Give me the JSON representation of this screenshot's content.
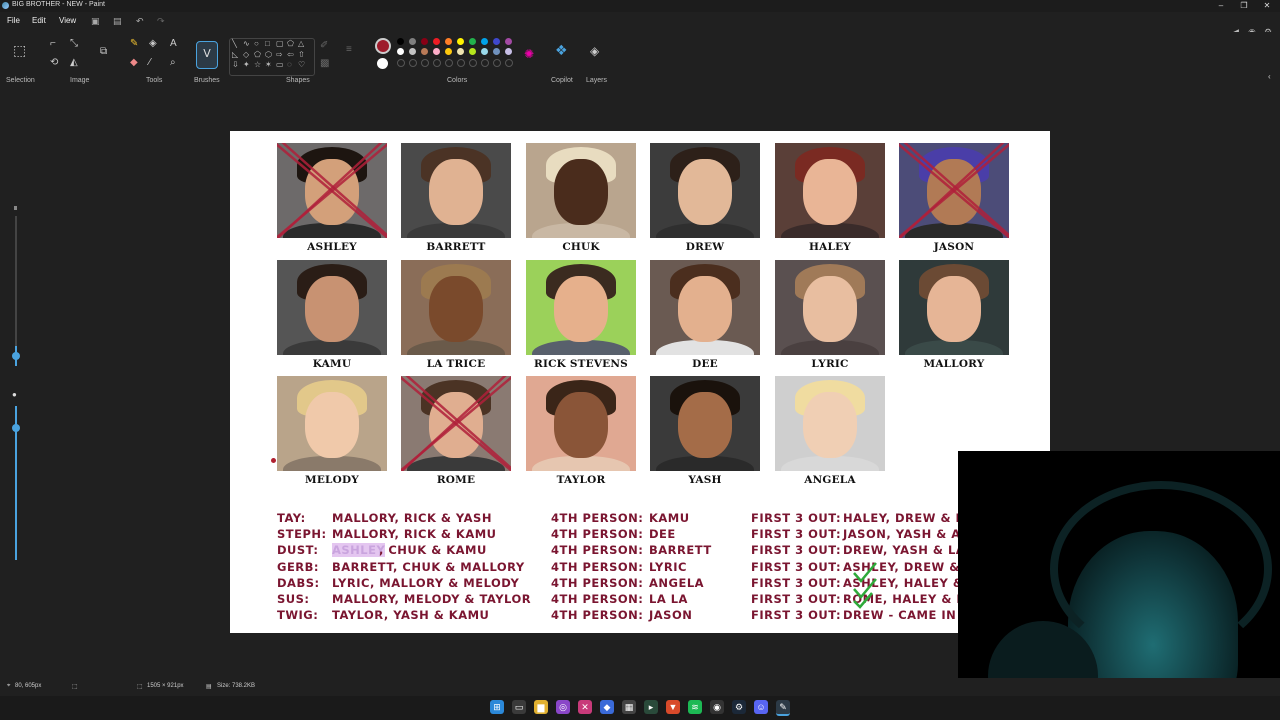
{
  "window": {
    "title": "BIG BROTHER - NEW - Paint",
    "minimize": "–",
    "maximize": "❐",
    "close": "✕"
  },
  "menu": {
    "file": "File",
    "edit": "Edit",
    "view": "View"
  },
  "ribbon": {
    "groups": {
      "selection": "Selection",
      "image": "Image",
      "tools": "Tools",
      "brushes": "Brushes",
      "shapes": "Shapes",
      "colors": "Colors",
      "copilot": "Copilot",
      "layers": "Layers"
    },
    "primary_color": "#9e1b2b",
    "secondary_color": "#ffffff",
    "palette_row1": [
      "#000000",
      "#7f7f7f",
      "#880015",
      "#ed1c24",
      "#ff7f27",
      "#fff200",
      "#22b14c",
      "#00a2e8",
      "#3f48cc",
      "#a349a4"
    ],
    "palette_row2": [
      "#ffffff",
      "#c3c3c3",
      "#b97a57",
      "#ffaec9",
      "#ffc90e",
      "#efe4b0",
      "#b5e61d",
      "#99d9ea",
      "#7092be",
      "#c8bfe7"
    ]
  },
  "contestants": [
    {
      "name": "ASHLEY",
      "x_mark": true,
      "bg": "#6d6a6a",
      "skin": "#d3a07a",
      "hair": "#1d1510",
      "shirt": "#2b2b2b"
    },
    {
      "name": "BARRETT",
      "x_mark": false,
      "bg": "#4a4a4a",
      "skin": "#e0b292",
      "hair": "#4b3325",
      "shirt": "#3a3a3a"
    },
    {
      "name": "CHUK",
      "x_mark": false,
      "bg": "#b9a58e",
      "skin": "#4a2c1c",
      "hair": "#e8dcc0",
      "shirt": "#c9b8a4"
    },
    {
      "name": "DREW",
      "x_mark": false,
      "bg": "#3c3c3c",
      "skin": "#e2b898",
      "hair": "#2d2019",
      "shirt": "#2f2f2f"
    },
    {
      "name": "HALEY",
      "x_mark": false,
      "bg": "#5a3f38",
      "skin": "#e9b596",
      "hair": "#7a2a22",
      "shirt": "#3a2b2a"
    },
    {
      "name": "JASON",
      "x_mark": true,
      "bg": "#4c4c78",
      "skin": "#b17a55",
      "hair": "#4a3ea8",
      "shirt": "#2a2a2a"
    },
    {
      "name": "KAMU",
      "x_mark": false,
      "bg": "#555555",
      "skin": "#c89272",
      "hair": "#2a1d16",
      "shirt": "#3a3a3a"
    },
    {
      "name": "LA TRICE",
      "x_mark": false,
      "bg": "#8a6d58",
      "skin": "#7a4a2c",
      "hair": "#9c7a50",
      "shirt": "#6a5a4a"
    },
    {
      "name": "RICK STEVENS",
      "x_mark": false,
      "bg": "#9bd15a",
      "skin": "#e6b08c",
      "hair": "#3b2b20",
      "shirt": "#58606c"
    },
    {
      "name": "DEE",
      "x_mark": false,
      "bg": "#6a5a52",
      "skin": "#e3b08e",
      "hair": "#4b2e1e",
      "shirt": "#e2e2e2"
    },
    {
      "name": "LYRIC",
      "x_mark": false,
      "bg": "#5a5050",
      "skin": "#e8bea0",
      "hair": "#a07a58",
      "shirt": "#4a4040"
    },
    {
      "name": "MALLORY",
      "x_mark": false,
      "bg": "#2f3a3a",
      "skin": "#e6b596",
      "hair": "#6b4a34",
      "shirt": "#3a4a48"
    },
    {
      "name": "MELODY",
      "x_mark": false,
      "bg": "#b9a48a",
      "skin": "#f0c9aa",
      "hair": "#e2c88a",
      "shirt": "#8a7a6a"
    },
    {
      "name": "ROME",
      "x_mark": true,
      "bg": "#8a7a72",
      "skin": "#e0ae90",
      "hair": "#4b3324",
      "shirt": "#3a3a3a"
    },
    {
      "name": "TAYLOR",
      "x_mark": false,
      "bg": "#e0a892",
      "skin": "#8a5538",
      "hair": "#3a2518",
      "shirt": "#e6c6b0"
    },
    {
      "name": "YASH",
      "x_mark": false,
      "bg": "#3a3a3a",
      "skin": "#a46c48",
      "hair": "#1a120c",
      "shirt": "#2a2a2a"
    },
    {
      "name": "ANGELA",
      "x_mark": false,
      "bg": "#cfcfcf",
      "skin": "#f0cfb4",
      "hair": "#f0dca0",
      "shirt": "#d8d8d8"
    }
  ],
  "predictions": [
    {
      "person": "TAY:",
      "final3": "MALLORY, RICK & YASH",
      "fourth_label": "4TH PERSON:",
      "fourth": "KAMU",
      "out_label": "FIRST 3 OUT:",
      "out": "HALEY, DREW & M"
    },
    {
      "person": "STEPH:",
      "final3": "MALLORY, RICK & KAMU",
      "fourth_label": "4TH PERSON:",
      "fourth": "DEE",
      "out_label": "FIRST 3 OUT:",
      "out": "JASON, YASH & A"
    },
    {
      "person": "DUST:",
      "final3_highlight": "ASHLEY",
      "final3": ", CHUK & KAMU",
      "fourth_label": "4TH PERSON:",
      "fourth": "BARRETT",
      "out_label": "FIRST 3 OUT:",
      "out": "DREW, YASH & LA"
    },
    {
      "person": "GERB:",
      "final3": "BARRETT, CHUK & MALLORY",
      "fourth_label": "4TH PERSON:",
      "fourth": "LYRIC",
      "out_label": "FIRST 3 OUT:",
      "out": "ASHLEY, DREW & Y"
    },
    {
      "person": "DABS:",
      "final3": "LYRIC, MALLORY & MELODY",
      "fourth_label": "4TH PERSON:",
      "fourth": "ANGELA",
      "out_label": "FIRST 3 OUT:",
      "out": "ASHLEY, HALEY &"
    },
    {
      "person": "SUS:",
      "final3": "MALLORY, MELODY & TAYLOR",
      "fourth_label": "4TH PERSON:",
      "fourth": "LA LA",
      "out_label": "FIRST 3 OUT:",
      "out": "ROME, HALEY & D"
    },
    {
      "person": "TWIG:",
      "final3": "TAYLOR, YASH & KAMU",
      "fourth_label": "4TH PERSON:",
      "fourth": "JASON",
      "out_label": "FIRST 3 OUT:",
      "out": "DREW - CAME IN"
    }
  ],
  "status": {
    "cursor_pos": "80, 605px",
    "canvas_size": "1505 × 921px",
    "file_size": "Size: 738.2KB"
  }
}
